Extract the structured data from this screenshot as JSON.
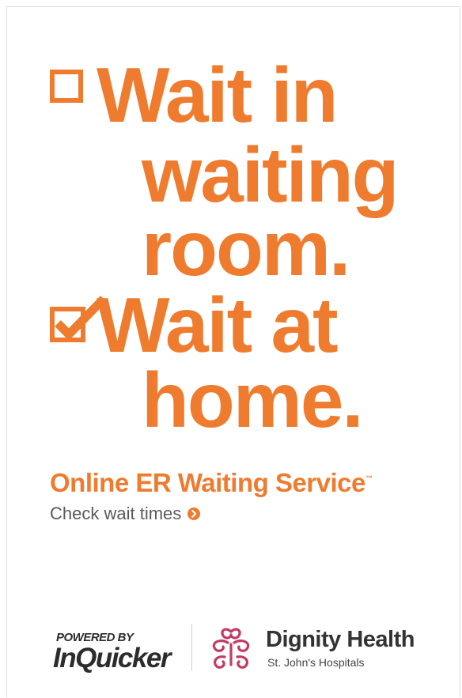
{
  "headline": {
    "line1": "Wait in",
    "line2": "waiting",
    "line3": "room.",
    "line4": "Wait at",
    "line5": "home."
  },
  "service": {
    "name": "Online ER Waiting Service",
    "trademark": "™"
  },
  "cta": {
    "label": "Check wait times",
    "icon": "chevron-right-circle-icon"
  },
  "footer": {
    "powered_by": "POWERED BY",
    "inquicker": "InQuicker",
    "dignity_name": "Dignity Health",
    "dignity_sub": "St. John's Hospitals"
  },
  "colors": {
    "accent": "#ef7b2e",
    "dignity_mark": "#c23b63",
    "text_dark": "#2c2c2c",
    "text_gray": "#5a5a5a"
  },
  "checkboxes": [
    {
      "label_key": "Wait in waiting room.",
      "checked": false
    },
    {
      "label_key": "Wait at home.",
      "checked": true
    }
  ]
}
